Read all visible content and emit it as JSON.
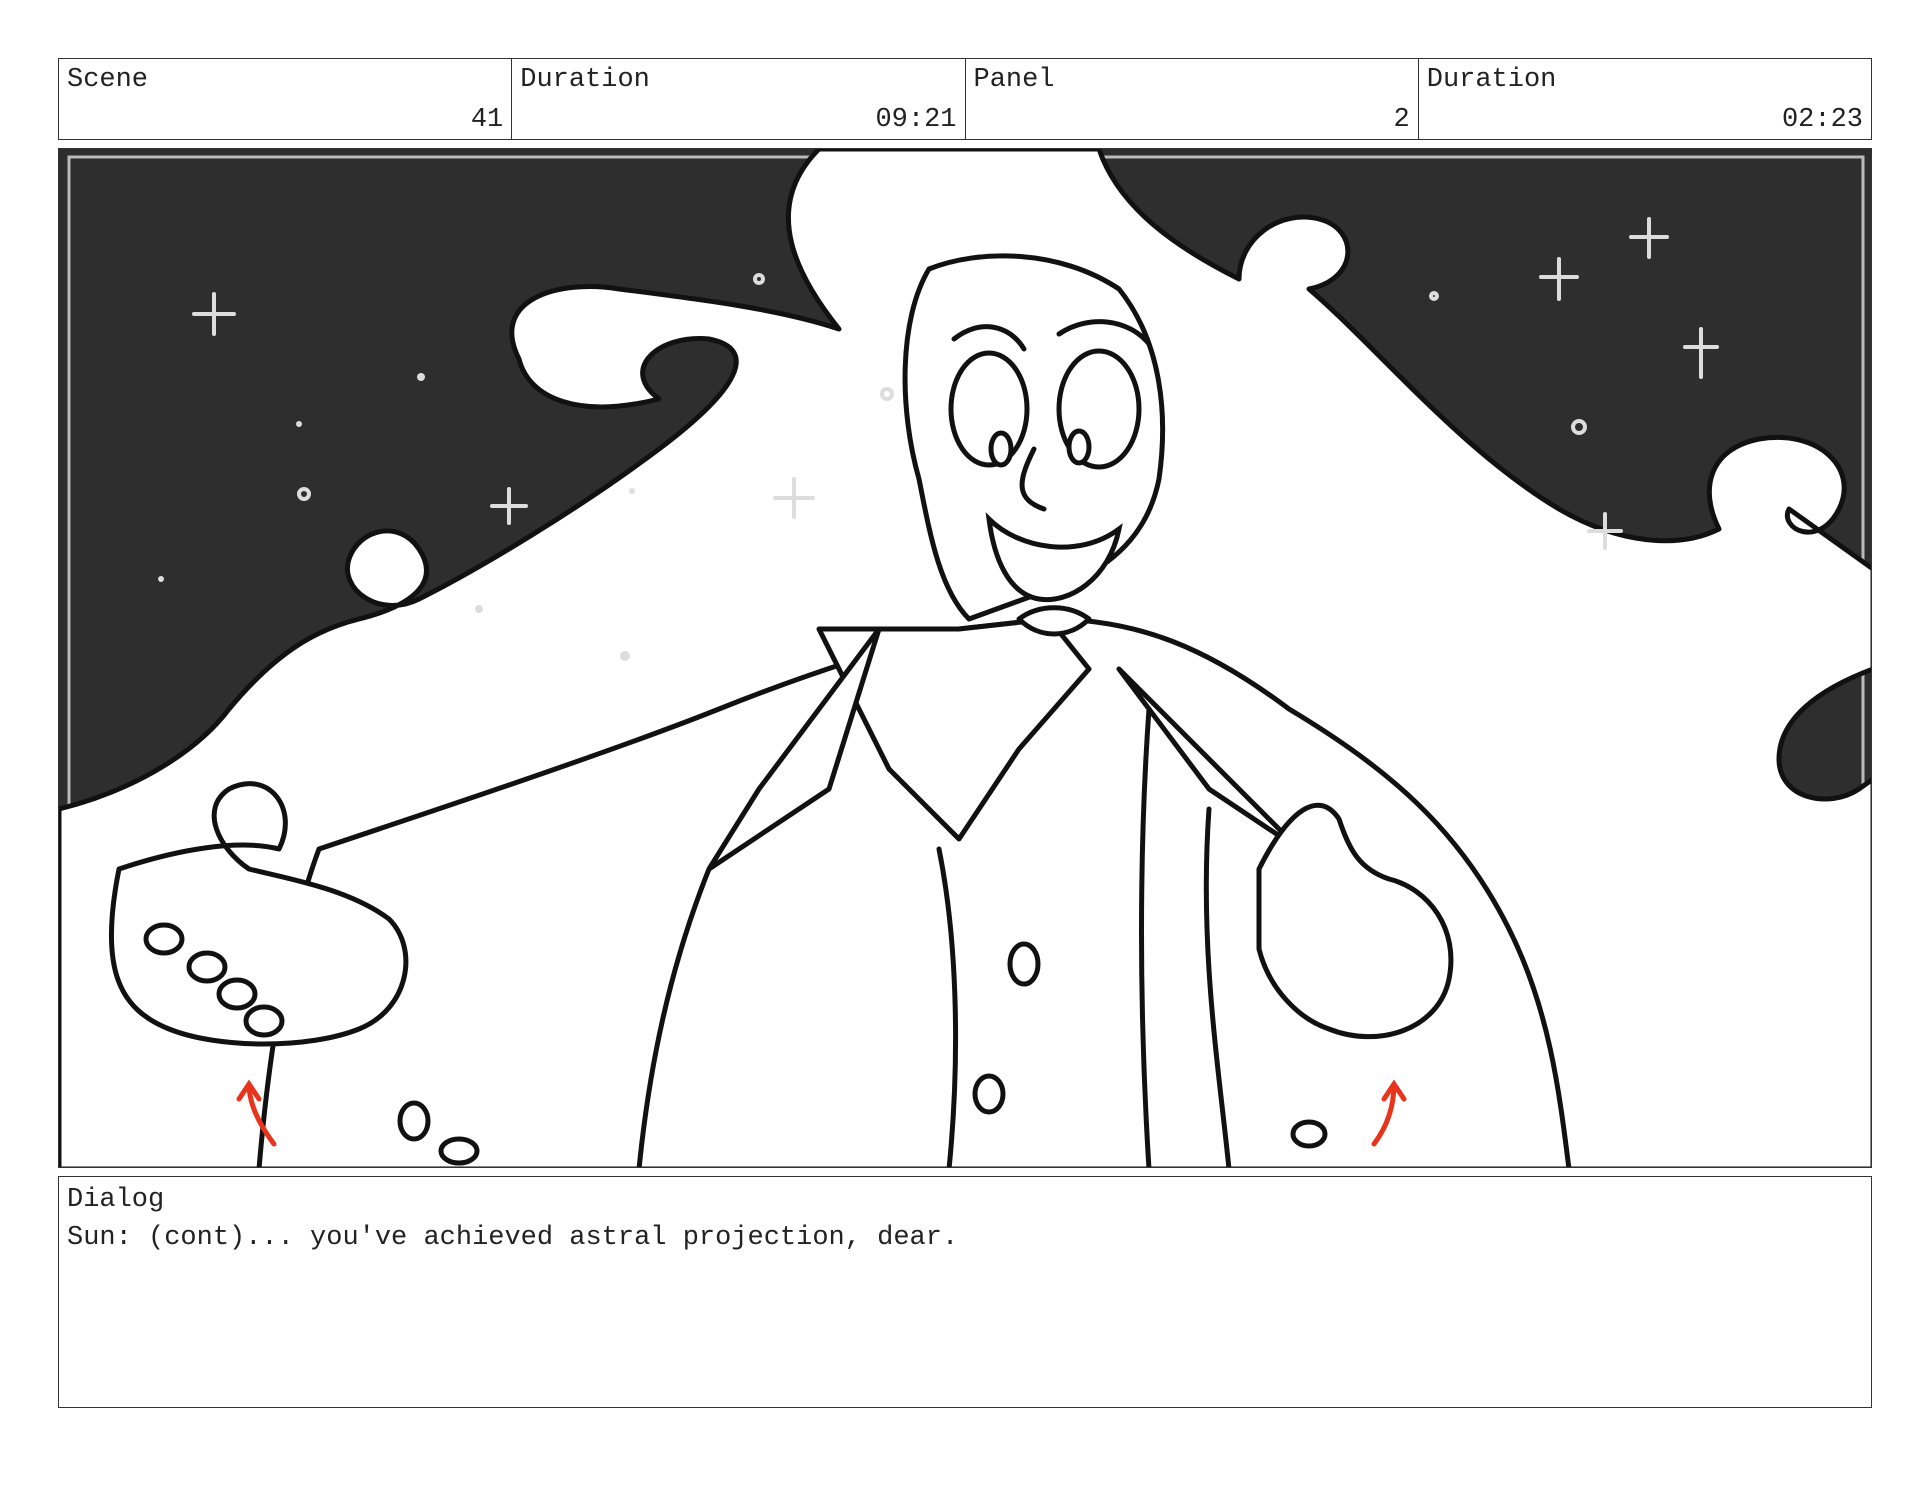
{
  "header": {
    "scene": {
      "label": "Scene",
      "value": "41"
    },
    "scene_duration": {
      "label": "Duration",
      "value": "09:21"
    },
    "panel": {
      "label": "Panel",
      "value": "2"
    },
    "panel_duration": {
      "label": "Duration",
      "value": "02:23"
    }
  },
  "panel_image": {
    "sky_color": "#2e2e2e",
    "ink_color": "#111111",
    "arrow_color": "#e8341c"
  },
  "dialog": {
    "label": "Dialog",
    "text": "Sun: (cont)... you've achieved astral projection, dear."
  }
}
